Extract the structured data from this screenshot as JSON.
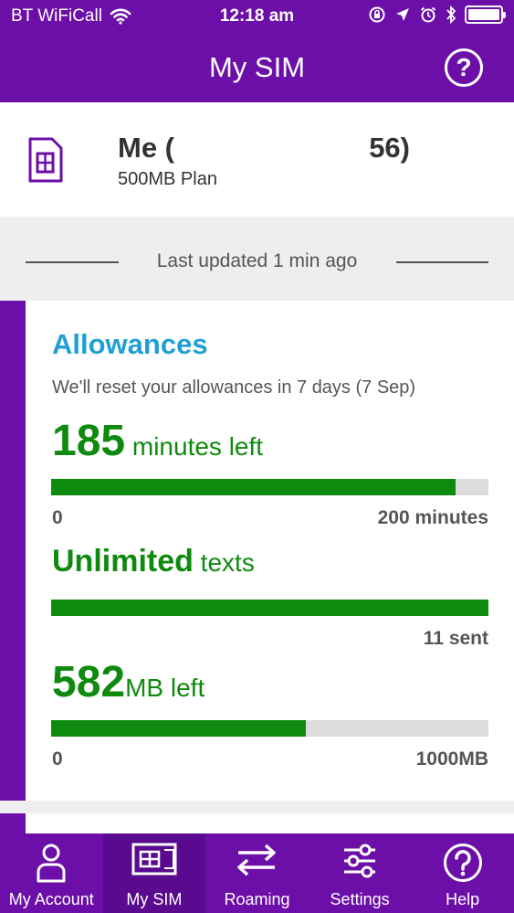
{
  "status_bar": {
    "carrier": "BT WiFiCall",
    "time": "12:18 am",
    "wifi_icon": "wifi-icon",
    "battery_icon": "battery-icon"
  },
  "header": {
    "title": "My SIM",
    "help_icon": "help-icon"
  },
  "sim": {
    "name_prefix": "Me (",
    "name_suffix": "56)",
    "plan": "500MB Plan",
    "icon": "sim-card-icon"
  },
  "updated_text": "Last updated 1 min ago",
  "allowances": {
    "title": "Allowances",
    "reset_text": "We'll reset your allowances in 7 days (7 Sep)",
    "minutes": {
      "value": "185",
      "unit": " minutes left",
      "fill_percent": 92.5,
      "min_label": "0",
      "max_label": "200 minutes"
    },
    "texts": {
      "value": "Unlimited",
      "unit": " texts",
      "fill_percent": 100,
      "sent_label": "11 sent"
    },
    "data": {
      "value": "582",
      "unit": "MB left",
      "fill_percent": 58.2,
      "min_label": "0",
      "max_label": "1000MB"
    }
  },
  "tabs": [
    {
      "label": "My Account",
      "icon": "person-icon"
    },
    {
      "label": "My SIM",
      "icon": "sim-icon",
      "active": true
    },
    {
      "label": "Roaming",
      "icon": "arrows-icon"
    },
    {
      "label": "Settings",
      "icon": "sliders-icon"
    },
    {
      "label": "Help",
      "icon": "help-icon"
    }
  ],
  "colors": {
    "brand_purple": "#6c0fa8",
    "allowance_blue": "#1ea0d4",
    "progress_green": "#0e8a0e"
  }
}
